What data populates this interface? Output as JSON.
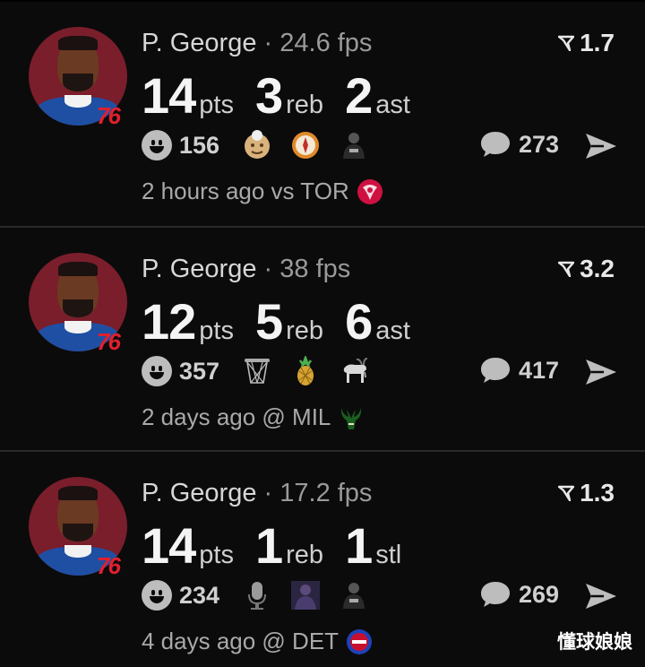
{
  "posts": [
    {
      "player": "P. George",
      "separator": "·",
      "fps": "24.6 fps",
      "rating": "1.7",
      "stats": [
        {
          "num": "14",
          "unit": "pts"
        },
        {
          "num": "3",
          "unit": "reb"
        },
        {
          "num": "2",
          "unit": "ast"
        }
      ],
      "reaction_count": "156",
      "reaction_icons": [
        "grandpa-face-icon",
        "compass-icon",
        "nets-player-icon"
      ],
      "comment_count": "273",
      "time": "2 hours ago vs TOR",
      "opponent_logo": "raptors-logo-icon"
    },
    {
      "player": "P. George",
      "separator": "·",
      "fps": "38 fps",
      "rating": "3.2",
      "stats": [
        {
          "num": "12",
          "unit": "pts"
        },
        {
          "num": "5",
          "unit": "reb"
        },
        {
          "num": "6",
          "unit": "ast"
        }
      ],
      "reaction_count": "357",
      "reaction_icons": [
        "basketball-net-icon",
        "pineapple-icon",
        "goat-icon"
      ],
      "comment_count": "417",
      "time": "2 days ago @ MIL",
      "opponent_logo": "bucks-logo-icon"
    },
    {
      "player": "P. George",
      "separator": "·",
      "fps": "17.2 fps",
      "rating": "1.3",
      "stats": [
        {
          "num": "14",
          "unit": "pts"
        },
        {
          "num": "1",
          "unit": "reb"
        },
        {
          "num": "1",
          "unit": "stl"
        }
      ],
      "reaction_count": "234",
      "reaction_icons": [
        "microphone-icon",
        "player-photo-icon",
        "nets-player-icon"
      ],
      "comment_count": "269",
      "time": "4 days ago @ DET",
      "opponent_logo": "pistons-logo-icon"
    }
  ],
  "team_badge": {
    "text": "76"
  },
  "watermark": "懂球娘娘",
  "colors": {
    "background": "#000000",
    "card": "#0b0b0b",
    "avatar_bg": "#7a1e2b",
    "jersey": "#1f4fa3",
    "sixers_red": "#e0202e"
  }
}
